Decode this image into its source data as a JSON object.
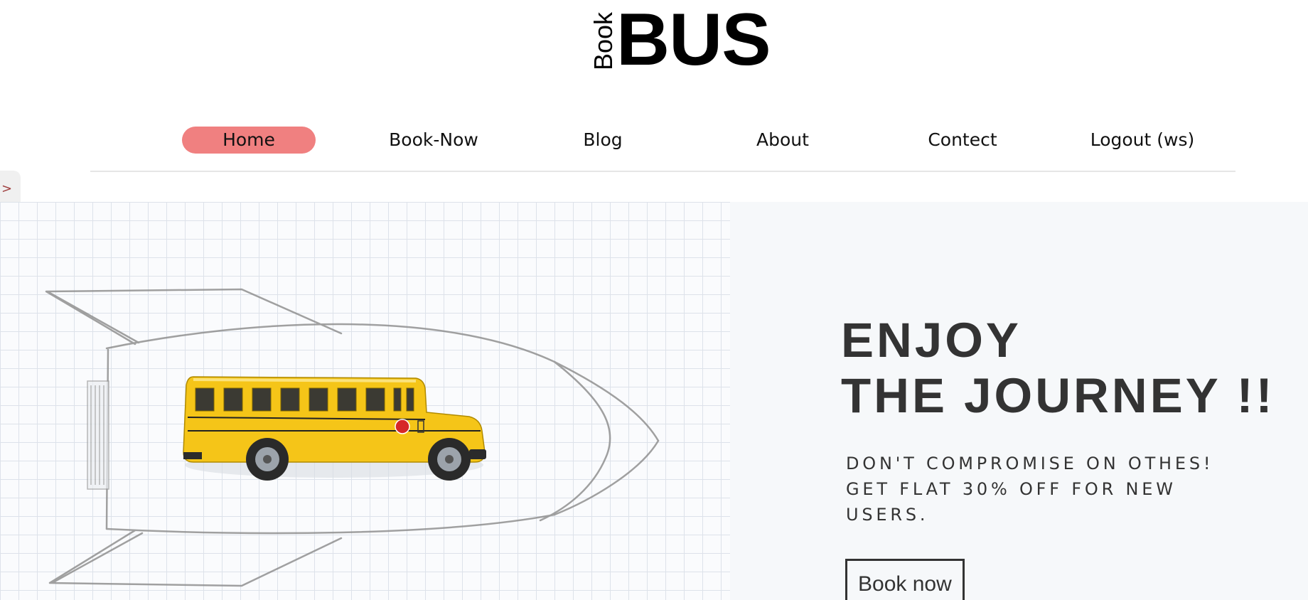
{
  "logo": {
    "small": "Book",
    "large": "BUS"
  },
  "nav": {
    "items": [
      {
        "label": "Home",
        "active": true
      },
      {
        "label": "Book-Now",
        "active": false
      },
      {
        "label": "Blog",
        "active": false
      },
      {
        "label": "About",
        "active": false
      },
      {
        "label": "Contect",
        "active": false
      },
      {
        "label": "Logout (ws)",
        "active": false
      }
    ]
  },
  "side_toggle": {
    "label": ">"
  },
  "hero": {
    "title_line1": "ENJOY",
    "title_line2": "THE JOURNEY !!",
    "subtitle": "DON'T COMPROMISE ON OTHES! GET FLAT 30% OFF FOR NEW USERS.",
    "button_label": "Book now",
    "image_icon": "school-bus-on-rocket-sketch"
  },
  "colors": {
    "active_nav_bg": "#f08080",
    "hero_bg": "#f6f8fa",
    "bus_yellow": "#f5c518",
    "text_dark": "#333333"
  }
}
